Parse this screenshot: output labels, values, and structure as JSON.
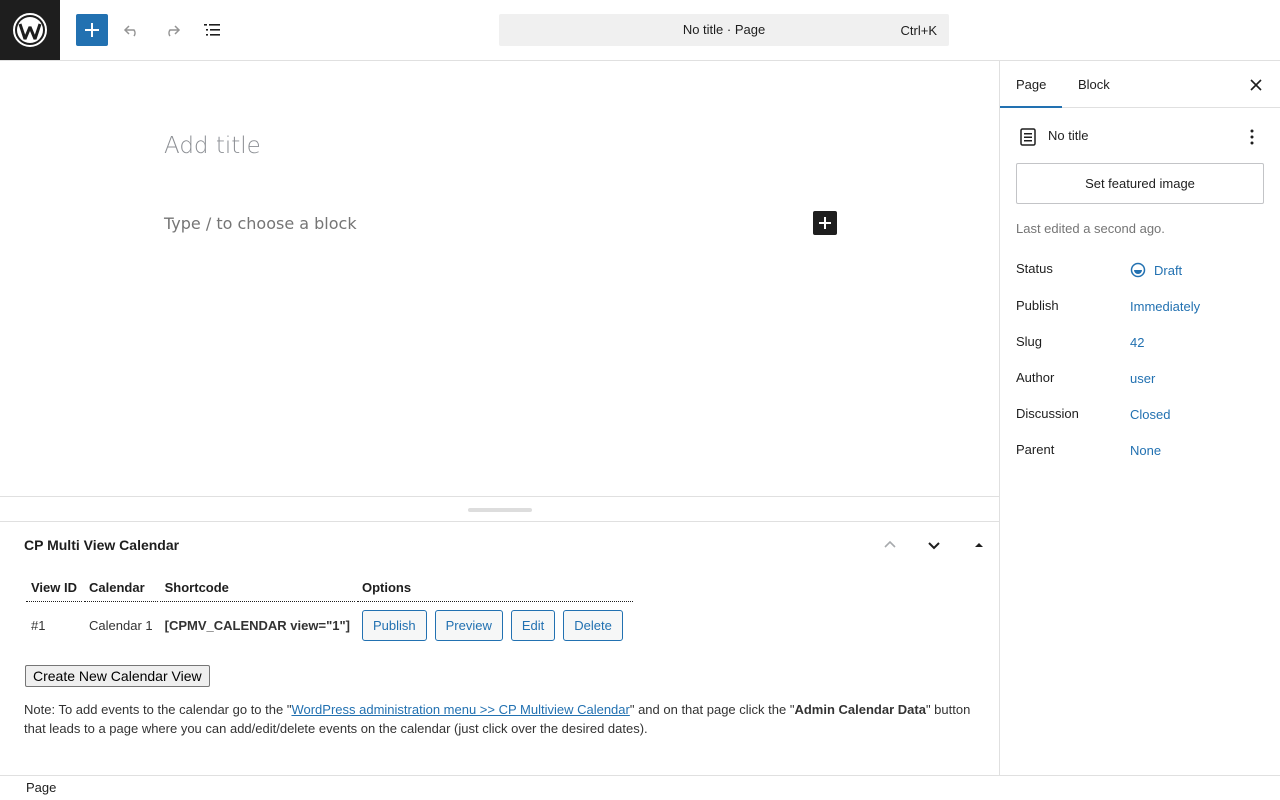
{
  "header": {
    "add_block_label": "+",
    "command_bar": {
      "title": "No title · Page",
      "shortcut": "Ctrl+K"
    },
    "icons": [
      "wordpress-logo",
      "plus-icon",
      "undo-icon",
      "redo-icon",
      "document-overview-icon"
    ]
  },
  "editor": {
    "title_placeholder": "Add title",
    "block_placeholder": "Type / to choose a block"
  },
  "metabox": {
    "title": "CP Multi View Calendar",
    "columns": [
      "View ID",
      "Calendar",
      "Shortcode",
      "Options"
    ],
    "rows": [
      {
        "id": "#1",
        "calendar": "Calendar 1",
        "shortcode": "[CPMV_CALENDAR view=\"1\"]"
      }
    ],
    "options": [
      "Publish",
      "Preview",
      "Edit",
      "Delete"
    ],
    "create_button": "Create New Calendar View",
    "note": {
      "before": "Note: To add events to the calendar go to the \"",
      "link": "WordPress administration menu >> CP Multiview Calendar",
      "middle": "\" and on that page click the \"",
      "bold": "Admin Calendar Data",
      "after": "\" button that leads to a page where you can add/edit/delete events on the calendar (just click over the desired dates)."
    }
  },
  "sidebar": {
    "tabs": [
      "Page",
      "Block"
    ],
    "active_tab": "Page",
    "doc_title": "No title",
    "featured_image_button": "Set featured image",
    "last_edited": "Last edited a second ago.",
    "properties": [
      {
        "label": "Status",
        "value": "Draft"
      },
      {
        "label": "Publish",
        "value": "Immediately"
      },
      {
        "label": "Slug",
        "value": "42"
      },
      {
        "label": "Author",
        "value": "user"
      },
      {
        "label": "Discussion",
        "value": "Closed"
      },
      {
        "label": "Parent",
        "value": "None"
      }
    ]
  },
  "footer": {
    "breadcrumb": "Page"
  },
  "colors": {
    "accent": "#2271b1",
    "dark": "#1e1e1e",
    "shortcode": "#2e8a27"
  }
}
